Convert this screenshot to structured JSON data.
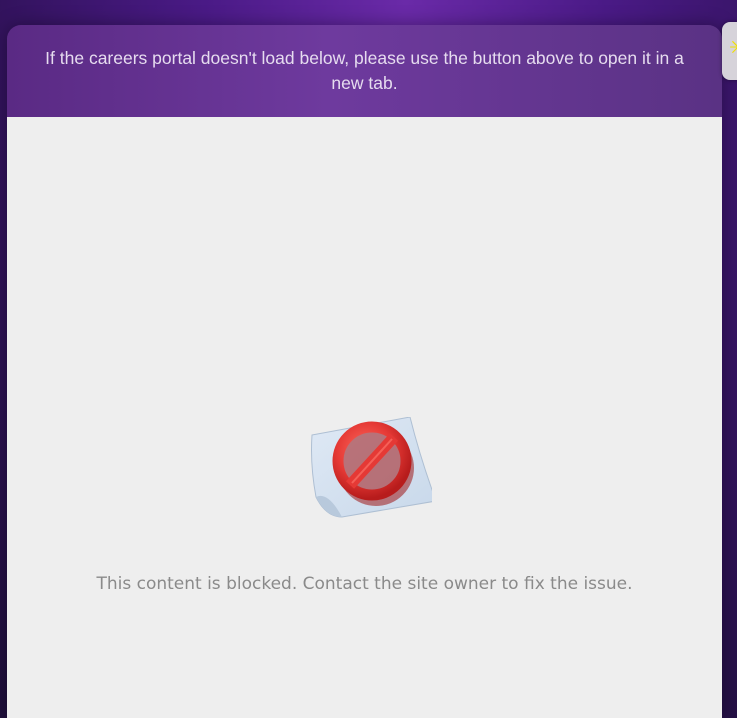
{
  "notice": {
    "text": "If the careers portal doesn't load below, please use the button above to open it in a new tab."
  },
  "embed": {
    "blocked_message": "This content is blocked. Contact the site owner to fix the issue.",
    "icon": "blocked-sign-icon"
  },
  "side_tab": {
    "icon": "sparkle-icon",
    "glyph": "✳"
  },
  "colors": {
    "background": "#4a1a86",
    "notice_bar": "#6e3a9e",
    "frame_background": "#eeeeee",
    "blocked_red": "#e53935"
  }
}
